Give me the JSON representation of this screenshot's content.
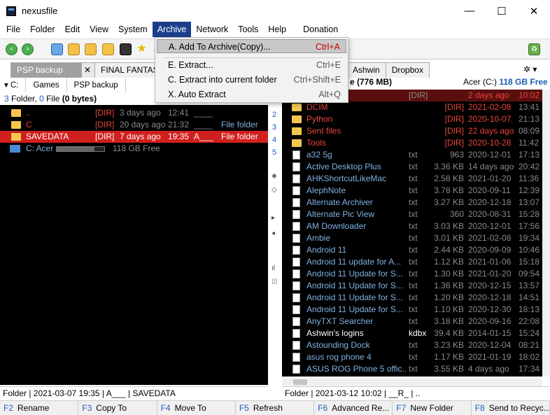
{
  "window": {
    "title": "nexusfile",
    "minimize": "—",
    "maximize": "☐",
    "close": "✕"
  },
  "menu": [
    "File",
    "Folder",
    "Edit",
    "View",
    "System",
    "Archive",
    "Network",
    "Tools",
    "Help",
    "Donation"
  ],
  "archive_menu": {
    "items": [
      {
        "label": "A. Add To Archive(Copy)...",
        "shortcut": "Ctrl+A"
      },
      {
        "label": "E. Extract...",
        "shortcut": "Ctrl+E"
      },
      {
        "label": "C. Extract into current folder",
        "shortcut": "Ctrl+Shift+E"
      },
      {
        "label": "X. Auto Extract",
        "shortcut": "Alt+Q"
      }
    ]
  },
  "left": {
    "tabs": [
      "PSP backup",
      "FINAL FANTASY"
    ],
    "tab_close": "✕",
    "breadcrumb": [
      "C:",
      "Games",
      "PSP backup"
    ],
    "summary": {
      "folders": "3",
      "folder_word": "Folder,",
      "files": "0",
      "file_word": "File",
      "bytes": "(0 bytes)"
    },
    "rows": [
      {
        "name": "..",
        "type": "[DIR]",
        "date": "3 days ago",
        "time": "12:41",
        "attr": "____",
        "desc": ""
      },
      {
        "name": "C",
        "type": "[DIR]",
        "date": "20 days ago",
        "time": "21:32",
        "attr": "____",
        "desc": "File folder"
      },
      {
        "name": "SAVEDATA",
        "type": "[DIR]",
        "date": "7 days ago",
        "time": "19:35",
        "attr": "A___",
        "desc": "File folder"
      }
    ],
    "drive": {
      "name": "C: Acer",
      "free": "118 GB Free",
      "used_fraction": 0.8
    },
    "status": "Folder | 2021-03-07 19:35 | A___ | SAVEDATA"
  },
  "middle": {
    "numbers": [
      "2",
      "3",
      "4",
      "5"
    ],
    "symbols": [
      "◈",
      "◇",
      "▸",
      "◂",
      "ıl",
      "⁞⁞⁞"
    ]
  },
  "right": {
    "tabs": [
      "Ashwin",
      "Dropbox"
    ],
    "header_size": "e (776 MB)",
    "drive_label": "Acer (C:)",
    "drive_free": "118 GB Free",
    "rows": [
      {
        "kind": "dir",
        "name": "",
        "ext": "[DIR]",
        "size": "",
        "date": "2 days ago",
        "time": "10:02"
      },
      {
        "kind": "dir",
        "name": "DCIM",
        "ext": "",
        "size": "[DIR]",
        "date": "2021-02-08",
        "time": "13:41"
      },
      {
        "kind": "dir",
        "name": "Python",
        "ext": "",
        "size": "[DIR]",
        "date": "2020-10-07",
        "time": "21:13"
      },
      {
        "kind": "dir",
        "name": "Sent files",
        "ext": "",
        "size": "[DIR]",
        "date": "22 days ago",
        "time": "08:09"
      },
      {
        "kind": "dir",
        "name": "Tools",
        "ext": "",
        "size": "[DIR]",
        "date": "2020-10-28",
        "time": "11:42"
      },
      {
        "kind": "file",
        "name": "a32 5g",
        "ext": "txt",
        "size": "963",
        "date": "2020-12-01",
        "time": "17:13"
      },
      {
        "kind": "file",
        "name": "Active Desktop Plus",
        "ext": "txt",
        "size": "3.36 KB",
        "date": "14 days ago",
        "time": "20:42"
      },
      {
        "kind": "file",
        "name": "AHKShortcutLikeMac",
        "ext": "txt",
        "size": "2.58 KB",
        "date": "2021-01-20",
        "time": "11:36"
      },
      {
        "kind": "file",
        "name": "AlephNote",
        "ext": "txt",
        "size": "3.78 KB",
        "date": "2020-09-11",
        "time": "12:39"
      },
      {
        "kind": "file",
        "name": "Alternate Archiver",
        "ext": "txt",
        "size": "3.27 KB",
        "date": "2020-12-18",
        "time": "13:07"
      },
      {
        "kind": "file",
        "name": "Alternate Pic View",
        "ext": "txt",
        "size": "360",
        "date": "2020-08-31",
        "time": "15:28"
      },
      {
        "kind": "file",
        "name": "AM Downloader",
        "ext": "txt",
        "size": "3.03 KB",
        "date": "2020-12-01",
        "time": "17:56"
      },
      {
        "kind": "file",
        "name": "Ambie",
        "ext": "txt",
        "size": "3.01 KB",
        "date": "2021-02-08",
        "time": "19:34"
      },
      {
        "kind": "file",
        "name": "Android 11",
        "ext": "txt",
        "size": "2.44 KB",
        "date": "2020-09-09",
        "time": "10:46"
      },
      {
        "kind": "file",
        "name": "Android 11 update for A...",
        "ext": "txt",
        "size": "1.12 KB",
        "date": "2021-01-06",
        "time": "15:18"
      },
      {
        "kind": "file",
        "name": "Android 11 Update for S...",
        "ext": "txt",
        "size": "1.30 KB",
        "date": "2021-01-20",
        "time": "09:54"
      },
      {
        "kind": "file",
        "name": "Android 11 Update for S...",
        "ext": "txt",
        "size": "1.36 KB",
        "date": "2020-12-15",
        "time": "13:57"
      },
      {
        "kind": "file",
        "name": "Android 11 Update for S...",
        "ext": "txt",
        "size": "1.20 KB",
        "date": "2020-12-18",
        "time": "14:51"
      },
      {
        "kind": "file",
        "name": "Android 11 Update for S...",
        "ext": "txt",
        "size": "1.10 KB",
        "date": "2020-12-30",
        "time": "18:13"
      },
      {
        "kind": "file",
        "name": "AnyTXT Searcher",
        "ext": "txt",
        "size": "3.18 KB",
        "date": "2020-09-16",
        "time": "22:08"
      },
      {
        "kind": "kdbx",
        "name": "Ashwin's logins",
        "ext": "kdbx",
        "size": "39.4 KB",
        "date": "2014-01-15",
        "time": "15:24"
      },
      {
        "kind": "file",
        "name": "Astounding Dock",
        "ext": "txt",
        "size": "3.23 KB",
        "date": "2020-12-04",
        "time": "08:21"
      },
      {
        "kind": "file",
        "name": "asus rog phone 4",
        "ext": "txt",
        "size": "1.17 KB",
        "date": "2021-01-19",
        "time": "18:02"
      },
      {
        "kind": "file",
        "name": "ASUS ROG Phone 5 offic...",
        "ext": "txt",
        "size": "3.55 KB",
        "date": "4 days ago",
        "time": "17:34"
      }
    ],
    "status": "Folder | 2021-03-12 10:02 | __R_ | .."
  },
  "fkeys": [
    {
      "key": "F2",
      "label": "Rename"
    },
    {
      "key": "F3",
      "label": "Copy To"
    },
    {
      "key": "F4",
      "label": "Move To"
    },
    {
      "key": "F5",
      "label": "Refresh"
    },
    {
      "key": "F6",
      "label": "Advanced Re..."
    },
    {
      "key": "F7",
      "label": "New Folder"
    },
    {
      "key": "F8",
      "label": "Send to Recyc..."
    }
  ],
  "colors": {
    "dir": "#e8443a",
    "file": "#7fb2e0",
    "kdbx": "#ffffff",
    "selected_bg": "#d0201e",
    "menu_active": "#1a3e8a"
  }
}
